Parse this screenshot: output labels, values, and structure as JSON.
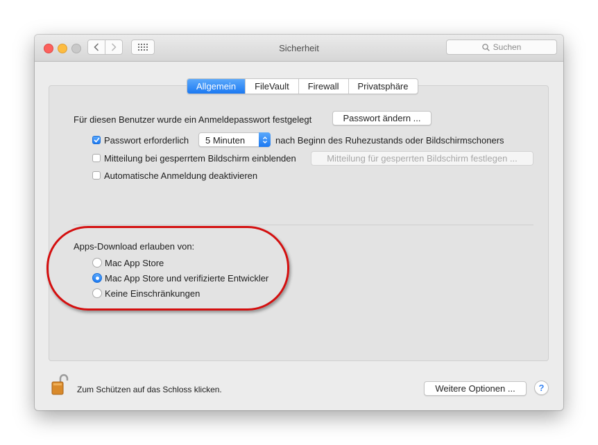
{
  "window": {
    "title": "Sicherheit"
  },
  "toolbar": {
    "search_placeholder": "Suchen"
  },
  "tabs": [
    {
      "label": "Allgemein",
      "active": true
    },
    {
      "label": "FileVault",
      "active": false
    },
    {
      "label": "Firewall",
      "active": false
    },
    {
      "label": "Privatsphäre",
      "active": false
    }
  ],
  "general": {
    "password_set_text": "Für diesen Benutzer wurde ein Anmeldepasswort festgelegt",
    "change_password_button": "Passwort ändern ...",
    "require_password": {
      "label": "Passwort erforderlich",
      "checked": true
    },
    "require_password_delay": "5 Minuten",
    "require_password_suffix": "nach Beginn des Ruhezustands oder Bildschirmschoners",
    "show_message": {
      "label": "Mitteilung bei gesperrtem Bildschirm einblenden",
      "checked": false
    },
    "set_message_button": "Mitteilung für gesperrten Bildschirm festlegen ...",
    "disable_autologin": {
      "label": "Automatische Anmeldung deaktivieren",
      "checked": false
    }
  },
  "downloads": {
    "heading": "Apps-Download erlauben von:",
    "options": [
      {
        "label": "Mac App Store",
        "selected": false
      },
      {
        "label": "Mac App Store und verifizierte Entwickler",
        "selected": true
      },
      {
        "label": "Keine Einschränkungen",
        "selected": false
      }
    ]
  },
  "footer": {
    "lock_text": "Zum Schützen auf das Schloss klicken.",
    "advanced_button": "Weitere Optionen ...",
    "help": "?"
  },
  "colors": {
    "accent": "#1b79f2",
    "annotation_red": "#d40f0f"
  }
}
